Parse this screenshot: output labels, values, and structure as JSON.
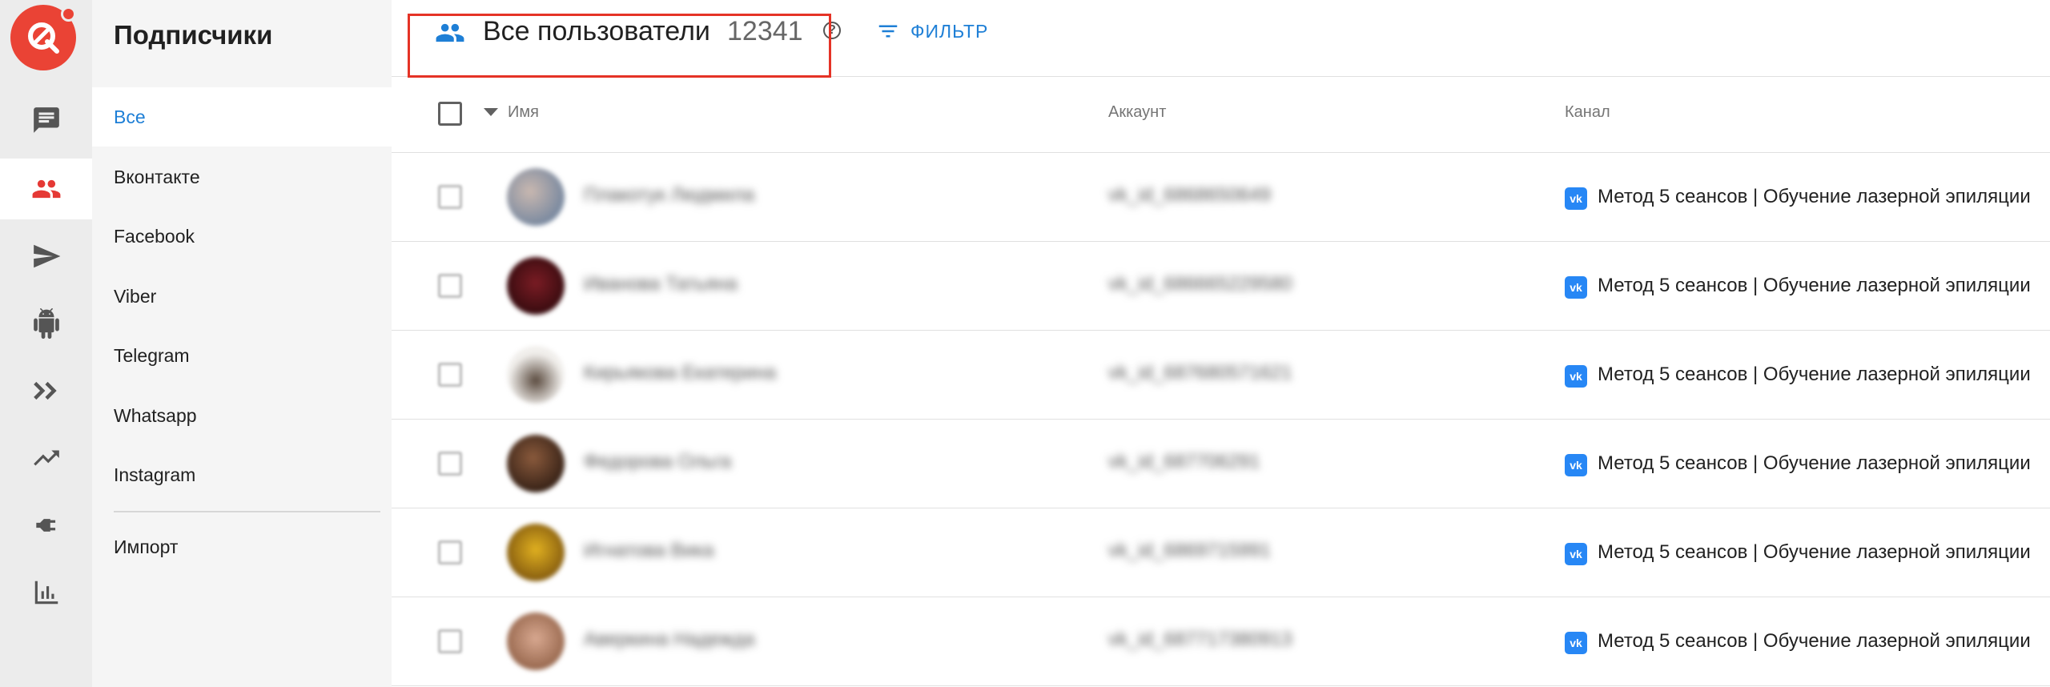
{
  "colors": {
    "brand_red": "#ea4335",
    "accent_blue": "#1e7fd6",
    "highlight_red": "#e53326",
    "vk_blue": "#2787f5"
  },
  "rail": {
    "items": [
      {
        "icon": "chat-icon",
        "active": false
      },
      {
        "icon": "users-icon",
        "active": true
      },
      {
        "icon": "send-icon",
        "active": false
      },
      {
        "icon": "android-bot-icon",
        "active": false
      },
      {
        "icon": "double-chevron-icon",
        "active": false
      },
      {
        "icon": "trending-up-icon",
        "active": false
      },
      {
        "icon": "plug-icon",
        "active": false
      },
      {
        "icon": "bar-chart-icon",
        "active": false
      }
    ]
  },
  "subnav": {
    "title": "Подписчики",
    "items": [
      "Все",
      "Вконтакте",
      "Facebook",
      "Viber",
      "Telegram",
      "Whatsapp",
      "Instagram"
    ],
    "import_label": "Импорт"
  },
  "header": {
    "title": "Все пользователи",
    "count": "12341",
    "help": "?",
    "filter_label": "ФИЛЬТР"
  },
  "table": {
    "columns": [
      "Имя",
      "Аккаунт",
      "Канал"
    ],
    "rows": [
      {
        "name": "Плакотук Людмила",
        "account": "vk_id_6868650649",
        "channel": "Метод 5 сеансов | Обучение лазерной эпиляции",
        "channel_badge": "vk"
      },
      {
        "name": "Иванова Татьяна",
        "account": "vk_id_686665229580",
        "channel": "Метод 5 сеансов | Обучение лазерной эпиляции",
        "channel_badge": "vk"
      },
      {
        "name": "Кирьякова Екатерина",
        "account": "vk_id_687680571621",
        "channel": "Метод 5 сеансов | Обучение лазерной эпиляции",
        "channel_badge": "vk"
      },
      {
        "name": "Федорова Ольга",
        "account": "vk_id_687706291",
        "channel": "Метод 5 сеансов | Обучение лазерной эпиляции",
        "channel_badge": "vk"
      },
      {
        "name": "Игнатова Вика",
        "account": "vk_id_6869715991",
        "channel": "Метод 5 сеансов | Обучение лазерной эпиляции",
        "channel_badge": "vk"
      },
      {
        "name": "Аверкина Надежда",
        "account": "vk_id_687717380913",
        "channel": "Метод 5 сеансов | Обучение лазерной эпиляции",
        "channel_badge": "vk"
      }
    ]
  }
}
